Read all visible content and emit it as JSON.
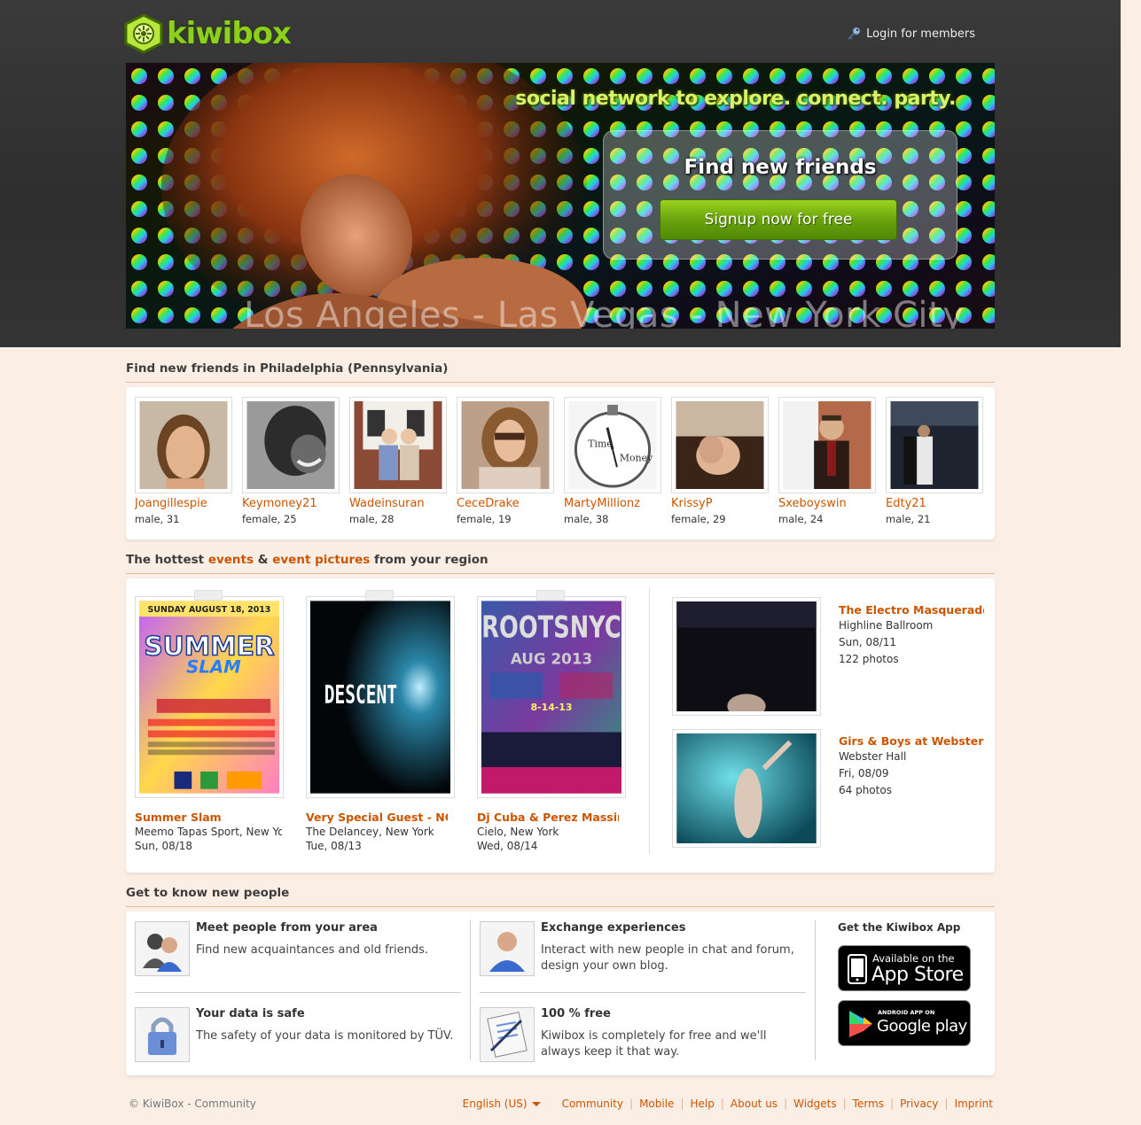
{
  "header": {
    "logo_text": "kiwibox",
    "login_label": "Login for members"
  },
  "hero": {
    "slogan": "social network to explore. connect. party.",
    "find_title": "Find new friends",
    "signup_label": "Signup now for free",
    "cities": "Los Angeles - Las Vegas - New York City"
  },
  "friends": {
    "title": "Find new friends in Philadelphia (Pennsylvania)",
    "users": [
      {
        "name": "Joangillespie",
        "info": "male, 31"
      },
      {
        "name": "Keymoney21",
        "info": "female, 25"
      },
      {
        "name": "Wadeinsuran",
        "info": "male, 28"
      },
      {
        "name": "CeceDrake",
        "info": "female, 19"
      },
      {
        "name": "MartyMillionz",
        "info": "male, 38"
      },
      {
        "name": "KrissyP",
        "info": "female, 29"
      },
      {
        "name": "Sxeboyswin",
        "info": "male, 24"
      },
      {
        "name": "Edty21",
        "info": "male, 21"
      }
    ]
  },
  "events": {
    "title_prefix": "The hottest ",
    "title_link1": "events",
    "title_amp": " & ",
    "title_link2": "event pictures",
    "title_suffix": " from your region",
    "items": [
      {
        "title": "Summer Slam",
        "venue": "Meemo Tapas Sport, New York",
        "date": "Sun, 08/18",
        "poster_header": "SUNDAY AUGUST 18, 2013",
        "poster_main": "SUMMER",
        "poster_sub": "SLAM"
      },
      {
        "title": "Very Special Guest - NO CAP",
        "venue": "The Delancey, New York",
        "date": "Tue, 08/13",
        "poster_main": "DESCENT"
      },
      {
        "title": "Dj Cuba & Perez Massimo",
        "venue": "Cielo, New York",
        "date": "Wed, 08/14",
        "poster_main": "ROOTSNYC",
        "poster_sub": "AUG 2013",
        "poster_date": "8-14-13"
      }
    ],
    "pictures": [
      {
        "title": "The Electro Masquerade Ball",
        "venue": "Highline Ballroom",
        "date": "Sun, 08/11",
        "count": "122 photos"
      },
      {
        "title": "Girs & Boys at Webster Hall",
        "venue": "Webster Hall",
        "date": "Fri, 08/09",
        "count": "64 photos"
      }
    ]
  },
  "features": {
    "title": "Get to know new people",
    "items": [
      {
        "title": "Meet people from your area",
        "text": "Find new acquaintances and old friends.",
        "icon": "people-icon"
      },
      {
        "title": "Exchange experiences",
        "text": "Interact with new people in chat and forum, design your own blog.",
        "icon": "person-icon"
      },
      {
        "title": "Your data is safe",
        "text": "The safety of your data is monitored by TÜV.",
        "icon": "lock-icon"
      },
      {
        "title": "100 % free",
        "text": "Kiwibox is completely for free and we'll always keep it that way.",
        "icon": "notepad-icon"
      }
    ],
    "app_title": "Get the Kiwibox App",
    "appstore_small": "Available on the",
    "appstore_big": "App Store",
    "googleplay_small": "ANDROID APP ON",
    "googleplay_big": "Google play"
  },
  "footer": {
    "copyright": "© KiwiBox - Community",
    "language": "English (US)",
    "links": [
      "Community",
      "Mobile",
      "Help",
      "About us",
      "Widgets",
      "Terms",
      "Privacy",
      "Imprint"
    ]
  },
  "colors": {
    "accent": "#cc5500",
    "brand_green": "#8ccf1c",
    "page_bg": "#fbeee4",
    "header_bg": "#333333"
  }
}
